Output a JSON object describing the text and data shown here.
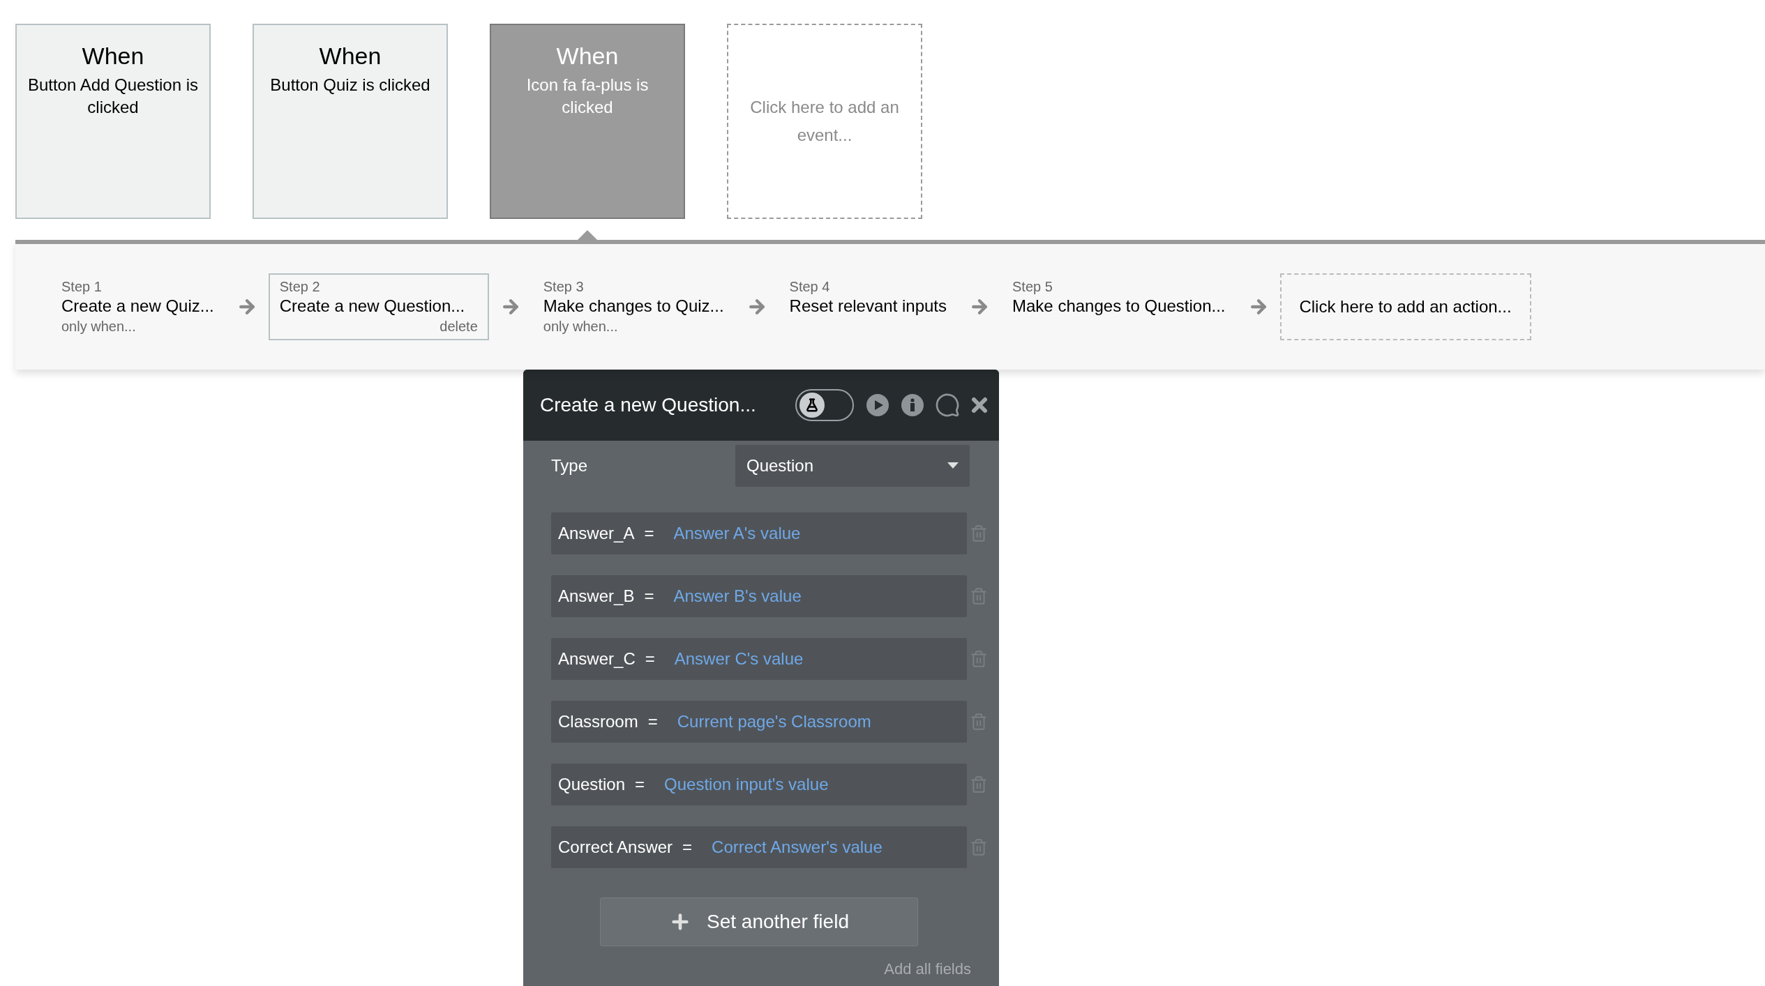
{
  "events": [
    {
      "title": "When",
      "description": "Button Add Question is clicked",
      "selected": false
    },
    {
      "title": "When",
      "description": "Button Quiz is clicked",
      "selected": false
    },
    {
      "title": "When",
      "description": "Icon fa fa-plus is clicked",
      "selected": true
    }
  ],
  "add_event": "Click here to add an event...",
  "steps": [
    {
      "label": "Step 1",
      "title": "Create a new Quiz...",
      "note": "only when...",
      "selected": false
    },
    {
      "label": "Step 2",
      "title": "Create a new Question...",
      "action": "delete",
      "selected": true
    },
    {
      "label": "Step 3",
      "title": "Make changes to Quiz...",
      "note": "only when...",
      "selected": false
    },
    {
      "label": "Step 4",
      "title": "Reset relevant inputs",
      "selected": false
    },
    {
      "label": "Step 5",
      "title": "Make changes to Question...",
      "selected": false
    }
  ],
  "add_action": "Click here to add an action...",
  "panel": {
    "title": "Create a new Question...",
    "debug_toggle": {
      "on": false
    },
    "type_field": {
      "label": "Type",
      "value": "Question"
    },
    "fields": [
      {
        "name": "Answer_A",
        "operator": "=",
        "value": "Answer A's value"
      },
      {
        "name": "Answer_B",
        "operator": "=",
        "value": "Answer B's value"
      },
      {
        "name": "Answer_C",
        "operator": "=",
        "value": "Answer C's value"
      },
      {
        "name": "Classroom",
        "operator": "=",
        "value": "Current page's Classroom"
      },
      {
        "name": "Question",
        "operator": "=",
        "value": "Question input's value"
      },
      {
        "name": "Correct Answer",
        "operator": "=",
        "value": "Correct Answer's value"
      }
    ],
    "add_button": "Set another field",
    "add_all_link": "Add all fields"
  }
}
